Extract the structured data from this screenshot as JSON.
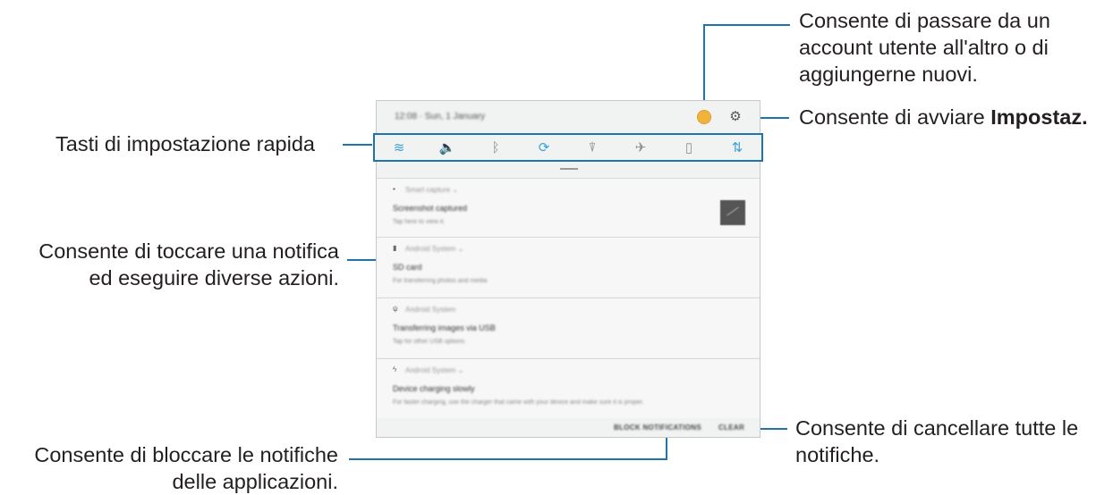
{
  "callouts": {
    "account_switch": [
      "Consente di passare da un",
      "account utente all'altro o di",
      "aggiungerne nuovi."
    ],
    "settings_prefix": "Consente di avviare ",
    "settings_bold": "Impostaz.",
    "quick_settings": "Tasti di impostazione rapida",
    "tap_notification": [
      "Consente di toccare una notifica",
      "ed eseguire diverse azioni."
    ],
    "clear_all": [
      "Consente di cancellare tutte le",
      "notifiche."
    ],
    "block_notifications": [
      "Consente di bloccare le notifiche",
      "delle applicazioni."
    ]
  },
  "panel": {
    "status_time": "12:08 · Sun, 1 January",
    "quick_icons": [
      {
        "icon": "wifi-icon",
        "glyph": "≋",
        "on": true
      },
      {
        "icon": "sound-icon",
        "glyph": "🔈",
        "on": true
      },
      {
        "icon": "bluetooth-icon",
        "glyph": "ᛒ",
        "on": false
      },
      {
        "icon": "auto-rotate-icon",
        "glyph": "⟳",
        "on": true
      },
      {
        "icon": "flashlight-icon",
        "glyph": "⍒",
        "on": false
      },
      {
        "icon": "airplane-icon",
        "glyph": "✈",
        "on": false
      },
      {
        "icon": "power-saving-icon",
        "glyph": "▯",
        "on": false
      },
      {
        "icon": "mobile-data-icon",
        "glyph": "⇅",
        "on": true
      }
    ],
    "notifications": [
      {
        "app": "Smart capture  ⌄",
        "title": "Screenshot captured",
        "sub": "Tap here to view it.",
        "icon": "image-icon",
        "glyph": "▪"
      },
      {
        "app": "Android System  ⌄",
        "title": "SD card",
        "sub": "For transferring photos and media",
        "icon": "sd-card-icon",
        "glyph": "▮"
      },
      {
        "app": "Android System",
        "title": "Transferring images via USB",
        "sub": "Tap for other USB options.",
        "icon": "usb-icon",
        "glyph": "ψ"
      },
      {
        "app": "Android System  ⌄",
        "title": "Device charging slowly",
        "sub": "For faster charging, use the charger that came with your device and make sure it is proper.",
        "icon": "charging-icon",
        "glyph": "ϟ"
      }
    ],
    "block_label": "BLOCK NOTIFICATIONS",
    "clear_label": "CLEAR"
  }
}
